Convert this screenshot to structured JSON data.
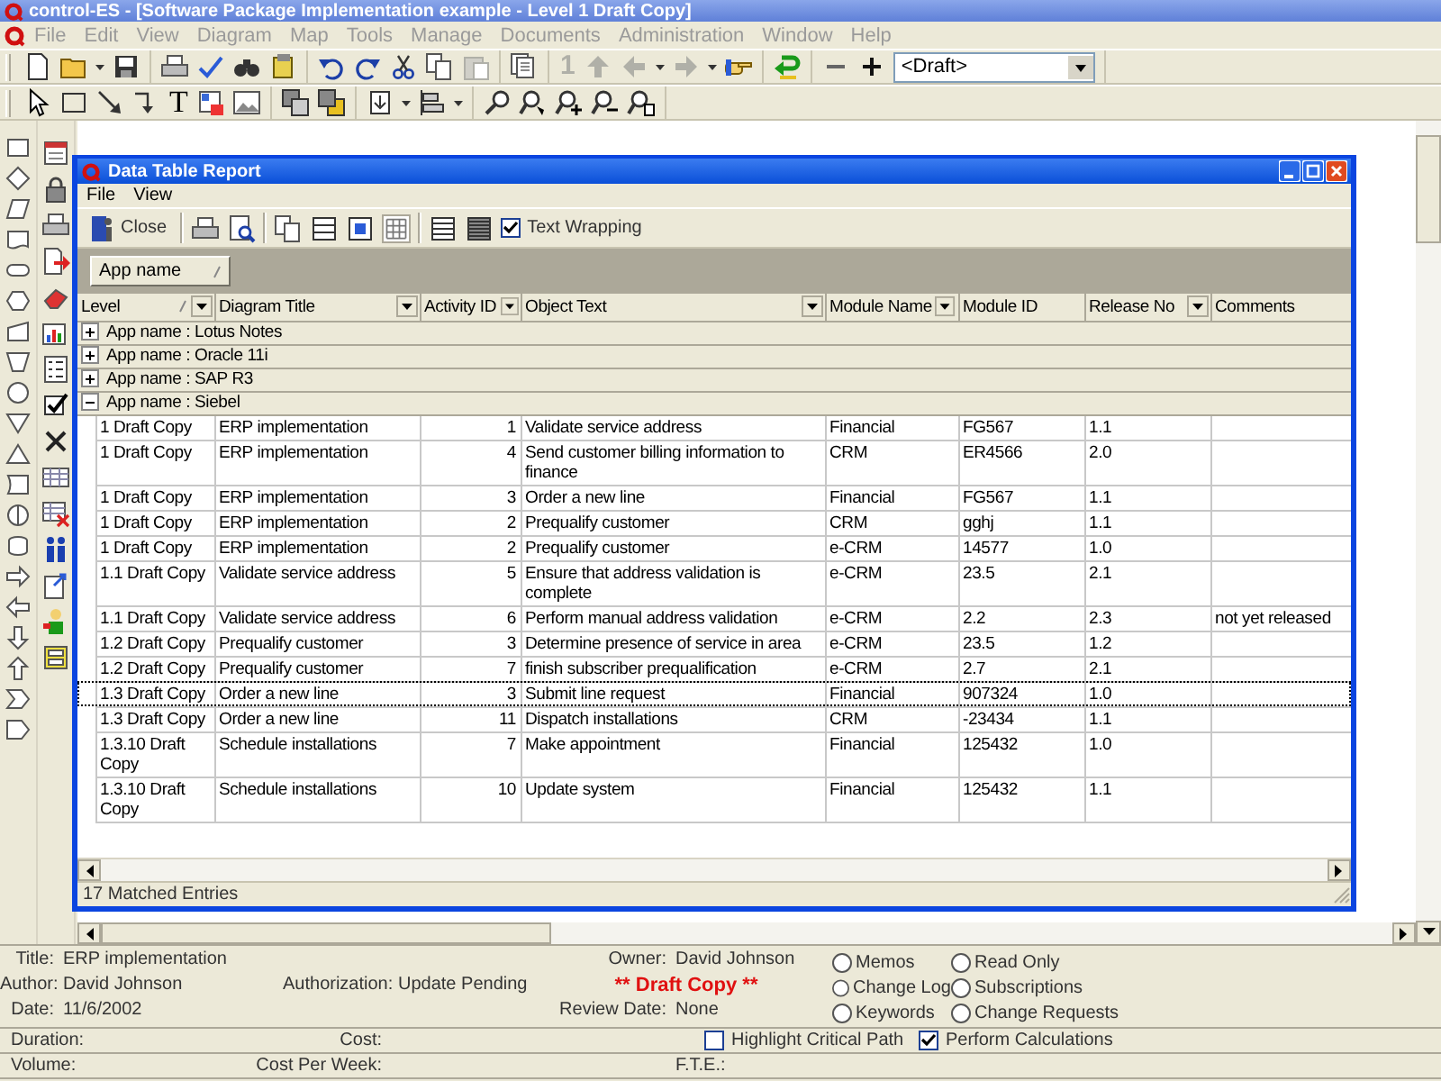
{
  "window": {
    "title": "control-ES - [Software Package Implementation example - Level 1 Draft Copy]"
  },
  "menu": [
    "File",
    "Edit",
    "View",
    "Diagram",
    "Map",
    "Tools",
    "Manage",
    "Documents",
    "Administration",
    "Window",
    "Help"
  ],
  "toolbar": {
    "paste_button": {
      "disabled": true
    },
    "number_button": {
      "label": "1",
      "disabled": true
    },
    "up_button": {
      "disabled": true
    },
    "back_button": {
      "disabled": true
    },
    "forward_button": {
      "disabled": true
    },
    "status_dropdown": "<Draft>",
    "text_tool": "T"
  },
  "report": {
    "title": "Data Table Report",
    "menu": [
      "File",
      "View"
    ],
    "close_button": "Close",
    "grid_button": {
      "on": true
    },
    "text_wrapping": {
      "label": "Text Wrapping",
      "checked": true
    },
    "group_by": [
      {
        "label": "App name",
        "sorted": true
      }
    ],
    "columns": [
      {
        "label": "Level",
        "sorted": true,
        "filter": true
      },
      {
        "label": "Diagram Title",
        "sorted": false,
        "filter": true
      },
      {
        "label": "Activity ID",
        "sorted": false,
        "filter": true
      },
      {
        "label": "Object Text",
        "sorted": false,
        "filter": true
      },
      {
        "label": "Module Name",
        "sorted": false,
        "filter": true
      },
      {
        "label": "Module ID",
        "sorted": false,
        "filter": false
      },
      {
        "label": "Release  No",
        "sorted": false,
        "filter": true
      },
      {
        "label": "Comments",
        "sorted": false,
        "filter": false
      }
    ],
    "groups": [
      {
        "label": "App name : Lotus Notes",
        "expanded": false
      },
      {
        "label": "App name : Oracle 11i",
        "expanded": false
      },
      {
        "label": "App name : SAP R3",
        "expanded": false
      },
      {
        "label": "App name : Siebel",
        "expanded": true,
        "rows": [
          {
            "cells": [
              "1 Draft Copy",
              "ERP implementation",
              "1",
              "Validate service address",
              "Financial",
              "FG567",
              "1.1"
            ],
            "focused": false
          },
          {
            "cells": [
              "1 Draft Copy",
              "ERP implementation",
              "4",
              "Send customer billing information to finance",
              "CRM",
              "ER4566",
              "2.0"
            ],
            "focused": false
          },
          {
            "cells": [
              "1 Draft Copy",
              "ERP implementation",
              "3",
              "Order a new line",
              "Financial",
              "FG567",
              "1.1"
            ],
            "focused": false
          },
          {
            "cells": [
              "1 Draft Copy",
              "ERP implementation",
              "2",
              "Prequalify customer",
              "CRM",
              "gghj",
              "1.1"
            ],
            "focused": false
          },
          {
            "cells": [
              "1 Draft Copy",
              "ERP implementation",
              "2",
              "Prequalify customer",
              "e-CRM",
              "14577",
              "1.0"
            ],
            "focused": false
          },
          {
            "cells": [
              "1.1 Draft Copy",
              "Validate service address",
              "5",
              "Ensure that address validation is complete",
              "e-CRM",
              "23.5",
              "2.1"
            ],
            "focused": false
          },
          {
            "cells": [
              "1.1 Draft Copy",
              "Validate service address",
              "6",
              "Perform manual address validation",
              "e-CRM",
              "2.2",
              "2.3",
              "not yet released"
            ],
            "focused": false
          },
          {
            "cells": [
              "1.2 Draft Copy",
              "Prequalify customer",
              "3",
              "Determine presence of service in area",
              "e-CRM",
              "23.5",
              "1.2"
            ],
            "focused": false
          },
          {
            "cells": [
              "1.2 Draft Copy",
              "Prequalify customer",
              "7",
              "finish subscriber prequalification",
              "e-CRM",
              "2.7",
              "2.1"
            ],
            "focused": false
          },
          {
            "cells": [
              "1.3 Draft Copy",
              "Order a new line",
              "3",
              "Submit line request",
              "Financial",
              "907324",
              "1.0"
            ],
            "focused": true
          },
          {
            "cells": [
              "1.3 Draft Copy",
              "Order a new line",
              "11",
              "Dispatch installations",
              "CRM",
              "-23434",
              "1.1"
            ],
            "focused": false
          },
          {
            "cells": [
              "1.3.10 Draft Copy",
              "Schedule installations",
              "7",
              "Make appointment",
              "Financial",
              "125432",
              "1.0"
            ],
            "focused": false
          },
          {
            "cells": [
              "1.3.10 Draft Copy",
              "Schedule installations",
              "10",
              "Update system",
              "Financial",
              "125432",
              "1.1"
            ],
            "focused": false
          }
        ]
      }
    ],
    "status": "17 Matched Entries"
  },
  "properties": {
    "title": {
      "label": "Title:",
      "value": "ERP implementation"
    },
    "author": {
      "label": "Author:",
      "value": "David Johnson"
    },
    "date": {
      "label": "Date:",
      "value": "11/6/2002"
    },
    "authorization": {
      "label": "Authorization:",
      "value": "Update Pending"
    },
    "owner": {
      "label": "Owner:",
      "value": "David Johnson"
    },
    "review_date": {
      "label": "Review Date:",
      "value": "None"
    },
    "notice": "** Draft Copy **",
    "options": [
      {
        "label": "Memos",
        "selected": false
      },
      {
        "label": "Read Only",
        "selected": false
      },
      {
        "label": "Change Log",
        "selected": false
      },
      {
        "label": "Subscriptions",
        "selected": false
      },
      {
        "label": "Keywords",
        "selected": false
      },
      {
        "label": "Change Requests",
        "selected": false
      }
    ],
    "duration": "Duration:",
    "cost": "Cost:",
    "highlight_critical_path": {
      "label": "Highlight Critical Path",
      "checked": false
    },
    "perform_calculations": {
      "label": "Perform Calculations",
      "checked": true
    },
    "volume": "Volume:",
    "cost_per_week": "Cost Per Week:",
    "fte": "F.T.E.:"
  }
}
